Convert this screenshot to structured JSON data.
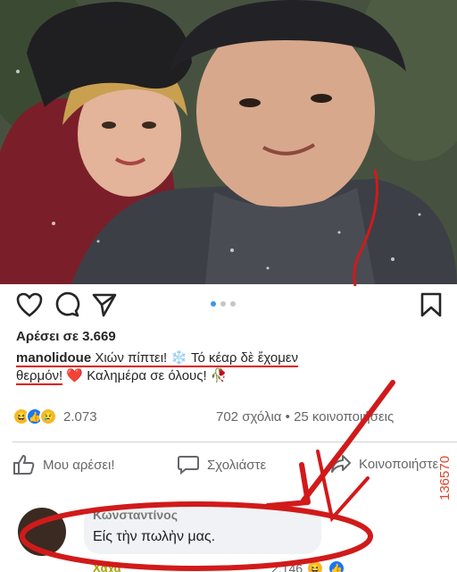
{
  "post": {
    "likes": "Αρέσει σε 3.669",
    "caption_user": "manolidoue",
    "caption_part1": " Χιών πίπτει! ❄️ Τό κέαρ δὲ ἔχομεν ",
    "caption_part2": "θερμόν!",
    "caption_part3": " ❤️ Καλημέρα σε όλους! 🥀"
  },
  "facebook": {
    "reactions_count": "2.073",
    "comments_shares": "702 σχόλια • 25 κοινοποιήσεις",
    "like_label": "Μου αρέσει!",
    "comment_label": "Σχολιάστε",
    "share_label": "Κοινοποιήστε"
  },
  "comment": {
    "author": "Κωνσταντίνος",
    "text": "Είς τὴν πωλὴν μας.",
    "reply": "Χαχα",
    "reaction_count": "2.146"
  },
  "watermark": "136570",
  "colors": {
    "annotation_red": "#d11a1a",
    "facebook_blue": "#1877f2"
  }
}
